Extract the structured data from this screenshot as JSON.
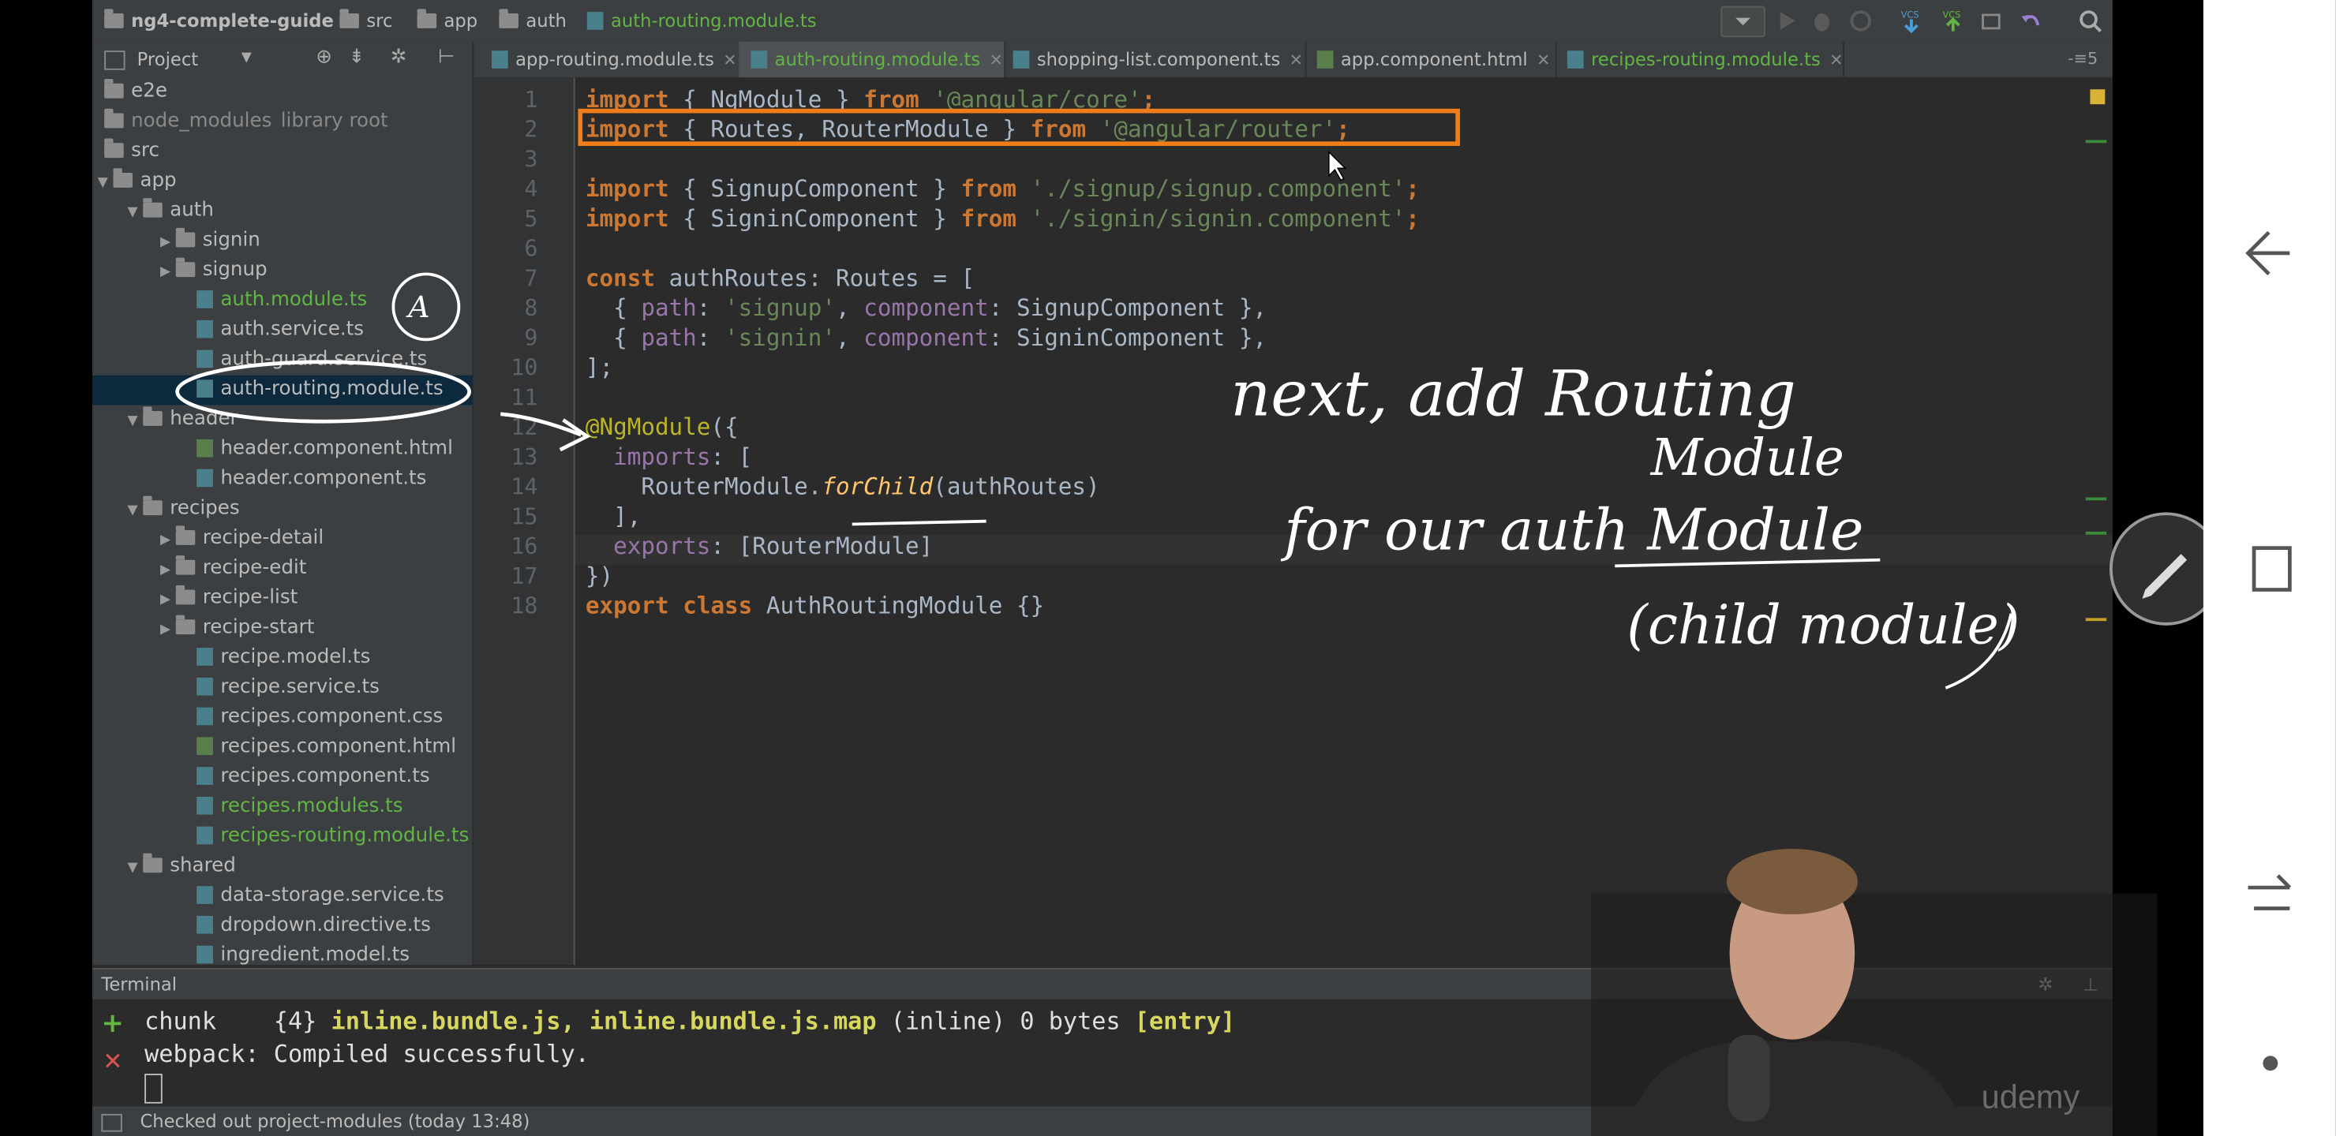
{
  "breadcrumbs": [
    "ng4-complete-guide",
    "src",
    "app",
    "auth",
    "auth-routing.module.ts"
  ],
  "tabs": [
    {
      "label": "app-routing.module.ts"
    },
    {
      "label": "auth-routing.module.ts"
    },
    {
      "label": "shopping-list.component.ts"
    },
    {
      "label": "app.component.html"
    },
    {
      "label": "recipes-routing.module.ts"
    }
  ],
  "project_panel": {
    "title": "Project",
    "tree": [
      "e2e",
      "node_modules",
      "library root",
      "src",
      "app",
      "auth",
      "signin",
      "signup",
      "auth.module.ts",
      "auth.service.ts",
      "auth-guard.service.ts",
      "auth-routing.module.ts",
      "header",
      "header.component.html",
      "header.component.ts",
      "recipes",
      "recipe-detail",
      "recipe-edit",
      "recipe-list",
      "recipe-start",
      "recipe.model.ts",
      "recipe.service.ts",
      "recipes.component.css",
      "recipes.component.html",
      "recipes.component.ts",
      "recipes.modules.ts",
      "recipes-routing.module.ts",
      "shared",
      "data-storage.service.ts",
      "dropdown.directive.ts",
      "ingredient.model.ts"
    ]
  },
  "editor": {
    "line_numbers": [
      "1",
      "2",
      "3",
      "4",
      "5",
      "6",
      "7",
      "8",
      "9",
      "10",
      "11",
      "12",
      "13",
      "14",
      "15",
      "16",
      "17",
      "18"
    ],
    "code": {
      "l1": [
        "import",
        " { NgModule } ",
        "from",
        " ",
        "'@angular/core'",
        ";"
      ],
      "l2": [
        "import",
        " { Routes, RouterModule } ",
        "from",
        " ",
        "'@angular/router'",
        ";"
      ],
      "l4": [
        "import",
        " { SignupComponent } ",
        "from",
        " ",
        "'./signup/signup.component'",
        ";"
      ],
      "l5": [
        "import",
        " { SigninComponent } ",
        "from",
        " ",
        "'./signin/signin.component'",
        ";"
      ],
      "l7": [
        "const",
        " authRoutes: Routes = ["
      ],
      "l8": [
        "  { ",
        "path",
        ": ",
        "'signup'",
        ", ",
        "component",
        ": SignupComponent },"
      ],
      "l9": [
        "  { ",
        "path",
        ": ",
        "'signin'",
        ", ",
        "component",
        ": SigninComponent },"
      ],
      "l10": [
        "];"
      ],
      "l12": [
        "@NgModule",
        "({"
      ],
      "l13": [
        "  ",
        "imports",
        ": ["
      ],
      "l14": [
        "    RouterModule.",
        "forChild",
        "(authRoutes)"
      ],
      "l15": [
        "  ],"
      ],
      "l16": [
        "  ",
        "exports",
        ": [RouterModule]"
      ],
      "l17": [
        "})"
      ],
      "l18": [
        "export",
        " ",
        "class",
        " AuthRoutingModule {}"
      ]
    }
  },
  "terminal": {
    "title": "Terminal",
    "line1": [
      "chunk    {4} ",
      "inline.bundle.js, inline.bundle.js.map",
      " (inline) 0 bytes ",
      "[entry]"
    ],
    "line2": "webpack: Compiled successfully.",
    "add_glyph": "+",
    "close_glyph": "✕"
  },
  "status": {
    "text": "Checked out project-modules (today 13:48)"
  },
  "annotations": {
    "circle_letter": "A",
    "note_line1": "next, add Routing",
    "note_line2": "Module",
    "note_line3": "for our auth Module",
    "note_line4": "(child module)"
  },
  "watermark": "udemy",
  "colors": {
    "highlight_box": "#f07d1a",
    "keyword": "#cc7832",
    "string": "#6a8759",
    "green_text": "#62b543"
  },
  "icons": [
    "search-icon",
    "run-icon",
    "debug-icon",
    "vcs-update-icon",
    "vcs-commit-icon",
    "undo-icon",
    "settings-icon",
    "android-back-icon",
    "android-recents-icon",
    "android-home-icon",
    "pen-icon"
  ]
}
